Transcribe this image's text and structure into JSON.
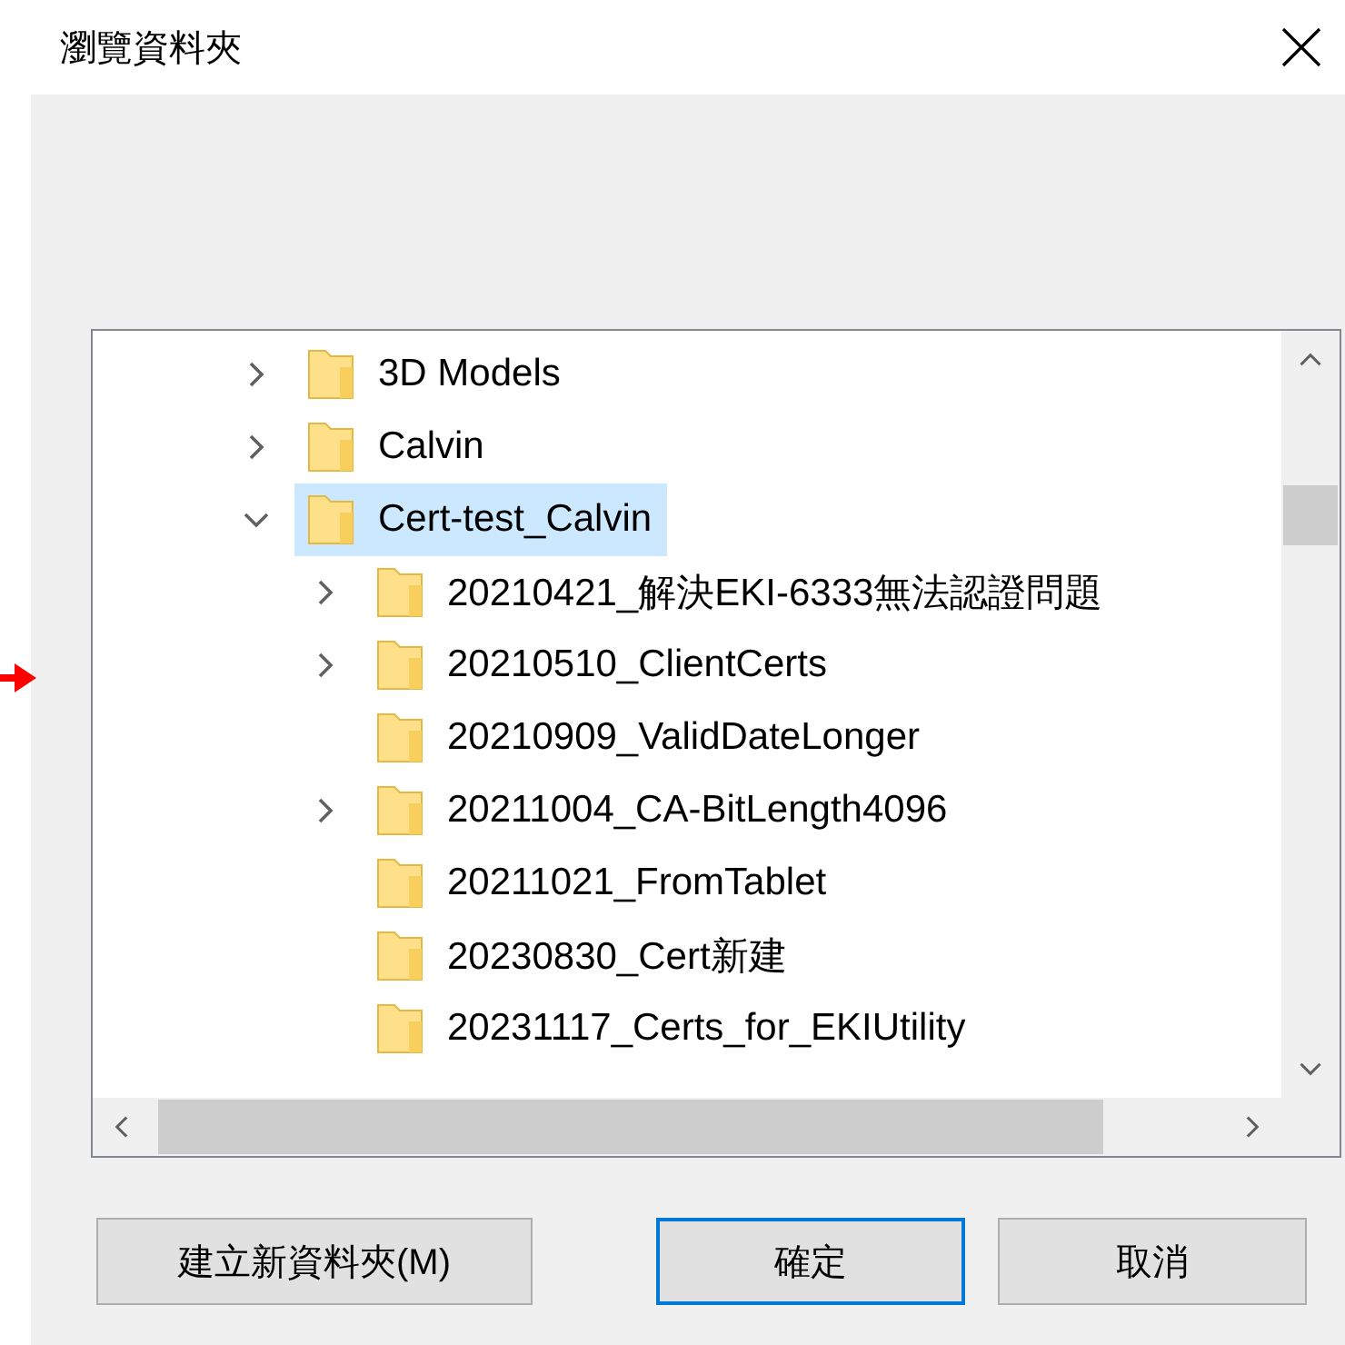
{
  "window": {
    "title": "瀏覽資料夾"
  },
  "annotation": {
    "kind": "arrow",
    "color": "#ff0000"
  },
  "tree": [
    {
      "label": "3D Models",
      "expandable": true,
      "expanded": false,
      "selected": false
    },
    {
      "label": "Calvin",
      "expandable": true,
      "expanded": false,
      "selected": false
    },
    {
      "label": "Cert-test_Calvin",
      "expandable": true,
      "expanded": true,
      "selected": true,
      "children": [
        {
          "label": "20210421_解決EKI-6333無法認證問題",
          "expandable": true,
          "expanded": false,
          "selected": false
        },
        {
          "label": "20210510_ClientCerts",
          "expandable": true,
          "expanded": false,
          "selected": false
        },
        {
          "label": "20210909_ValidDateLonger",
          "expandable": false,
          "selected": false
        },
        {
          "label": "20211004_CA-BitLength4096",
          "expandable": true,
          "expanded": false,
          "selected": false
        },
        {
          "label": "20211021_FromTablet",
          "expandable": false,
          "selected": false
        },
        {
          "label": "20230830_Cert新建",
          "expandable": false,
          "selected": false
        },
        {
          "label": "20231117_Certs_for_EKIUtility",
          "expandable": false,
          "selected": false
        }
      ]
    }
  ],
  "buttons": [
    {
      "label": "建立新資料夾(M)",
      "default": false
    },
    {
      "label": "確定",
      "default": true
    },
    {
      "label": "取消",
      "default": false
    }
  ]
}
